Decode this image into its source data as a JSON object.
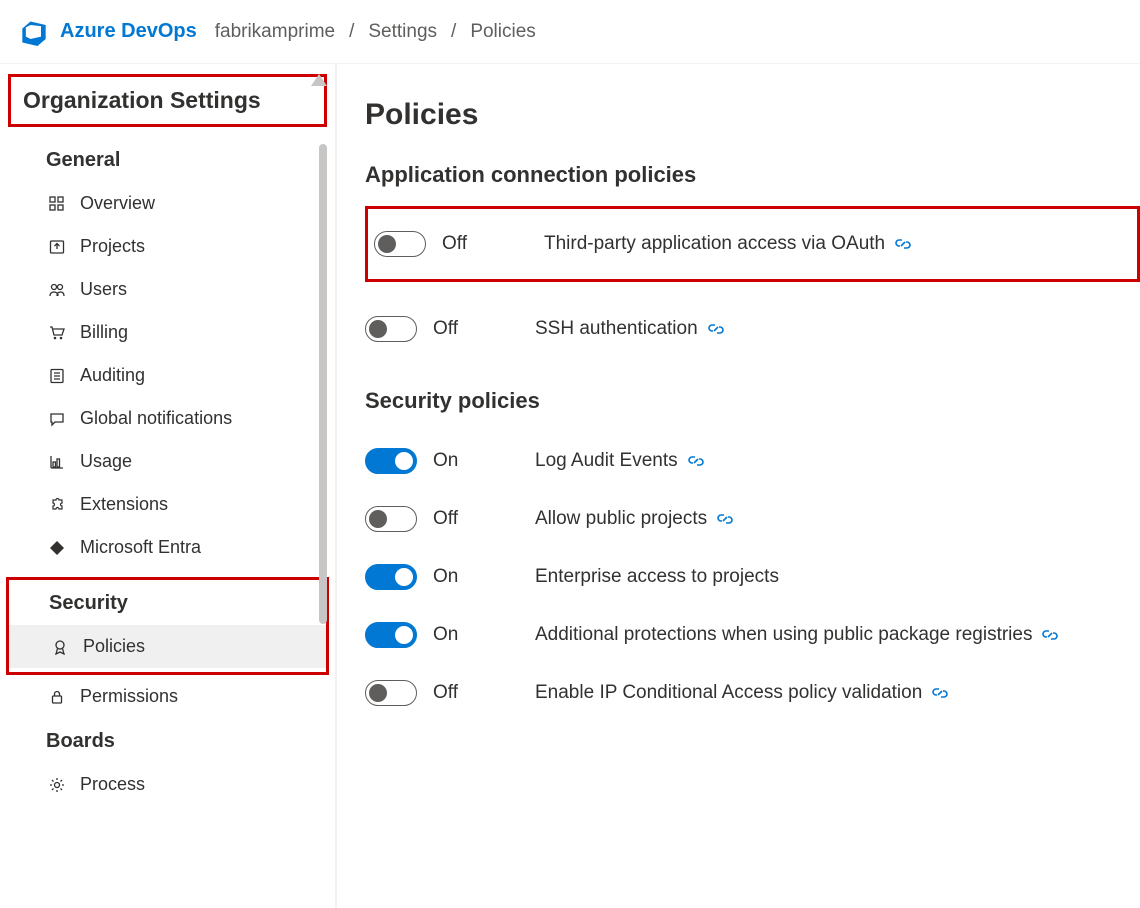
{
  "header": {
    "brand": "Azure DevOps",
    "breadcrumbs": [
      "fabrikamprime",
      "Settings",
      "Policies"
    ]
  },
  "sidebar": {
    "title": "Organization Settings",
    "sections": [
      {
        "title": "General",
        "items": [
          {
            "label": "Overview",
            "icon": "grid-icon"
          },
          {
            "label": "Projects",
            "icon": "upload-icon"
          },
          {
            "label": "Users",
            "icon": "users-icon"
          },
          {
            "label": "Billing",
            "icon": "cart-icon"
          },
          {
            "label": "Auditing",
            "icon": "list-icon"
          },
          {
            "label": "Global notifications",
            "icon": "chat-icon"
          },
          {
            "label": "Usage",
            "icon": "chart-icon"
          },
          {
            "label": "Extensions",
            "icon": "puzzle-icon"
          },
          {
            "label": "Microsoft Entra",
            "icon": "diamond-icon"
          }
        ]
      },
      {
        "title": "Security",
        "boxed": true,
        "items": [
          {
            "label": "Policies",
            "icon": "ribbon-icon",
            "selected": true
          },
          {
            "label": "Permissions",
            "icon": "lock-icon"
          }
        ]
      },
      {
        "title": "Boards",
        "items": [
          {
            "label": "Process",
            "icon": "gear-icon"
          }
        ]
      }
    ]
  },
  "main": {
    "title": "Policies",
    "groups": [
      {
        "heading": "Application connection policies",
        "policies": [
          {
            "label": "Third-party application access via OAuth",
            "on": false,
            "state": "Off",
            "link": true,
            "boxed": true
          },
          {
            "label": "SSH authentication",
            "on": false,
            "state": "Off",
            "link": true
          }
        ]
      },
      {
        "heading": "Security policies",
        "policies": [
          {
            "label": "Log Audit Events",
            "on": true,
            "state": "On",
            "link": true
          },
          {
            "label": "Allow public projects",
            "on": false,
            "state": "Off",
            "link": true
          },
          {
            "label": "Enterprise access to projects",
            "on": true,
            "state": "On",
            "link": false
          },
          {
            "label": "Additional protections when using public package registries",
            "on": true,
            "state": "On",
            "link": true
          },
          {
            "label": "Enable IP Conditional Access policy validation",
            "on": false,
            "state": "Off",
            "link": true
          }
        ]
      }
    ]
  }
}
